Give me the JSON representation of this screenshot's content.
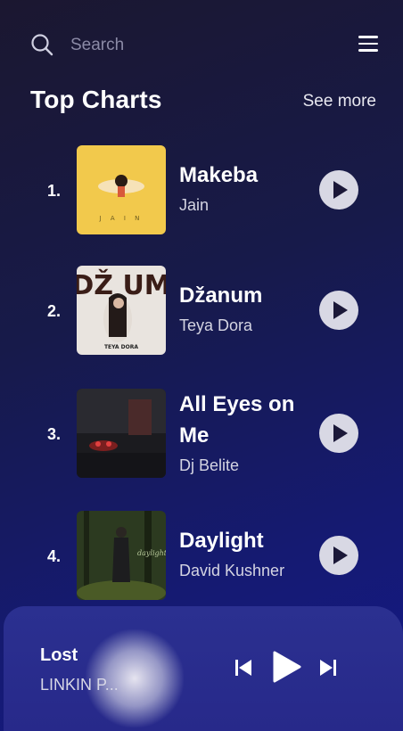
{
  "search": {
    "placeholder": "Search",
    "icon": "search-icon"
  },
  "menu": {
    "icon": "hamburger-menu-icon"
  },
  "section": {
    "title": "Top Charts",
    "see_more": "See more"
  },
  "tracks": [
    {
      "rank": "1.",
      "title": "Makeba",
      "artist": "Jain"
    },
    {
      "rank": "2.",
      "title": "Džanum",
      "artist": "Teya Dora"
    },
    {
      "rank": "3.",
      "title": "All Eyes on Me",
      "artist": "Dj Belite"
    },
    {
      "rank": "4.",
      "title": "Daylight",
      "artist": "David Kushner"
    }
  ],
  "now_playing": {
    "title": "Lost",
    "artist": "LINKIN P..."
  },
  "colors": {
    "accent_bg": "#151a72",
    "player_bg": "#2b3090",
    "play_button": "#d8d8e4"
  }
}
